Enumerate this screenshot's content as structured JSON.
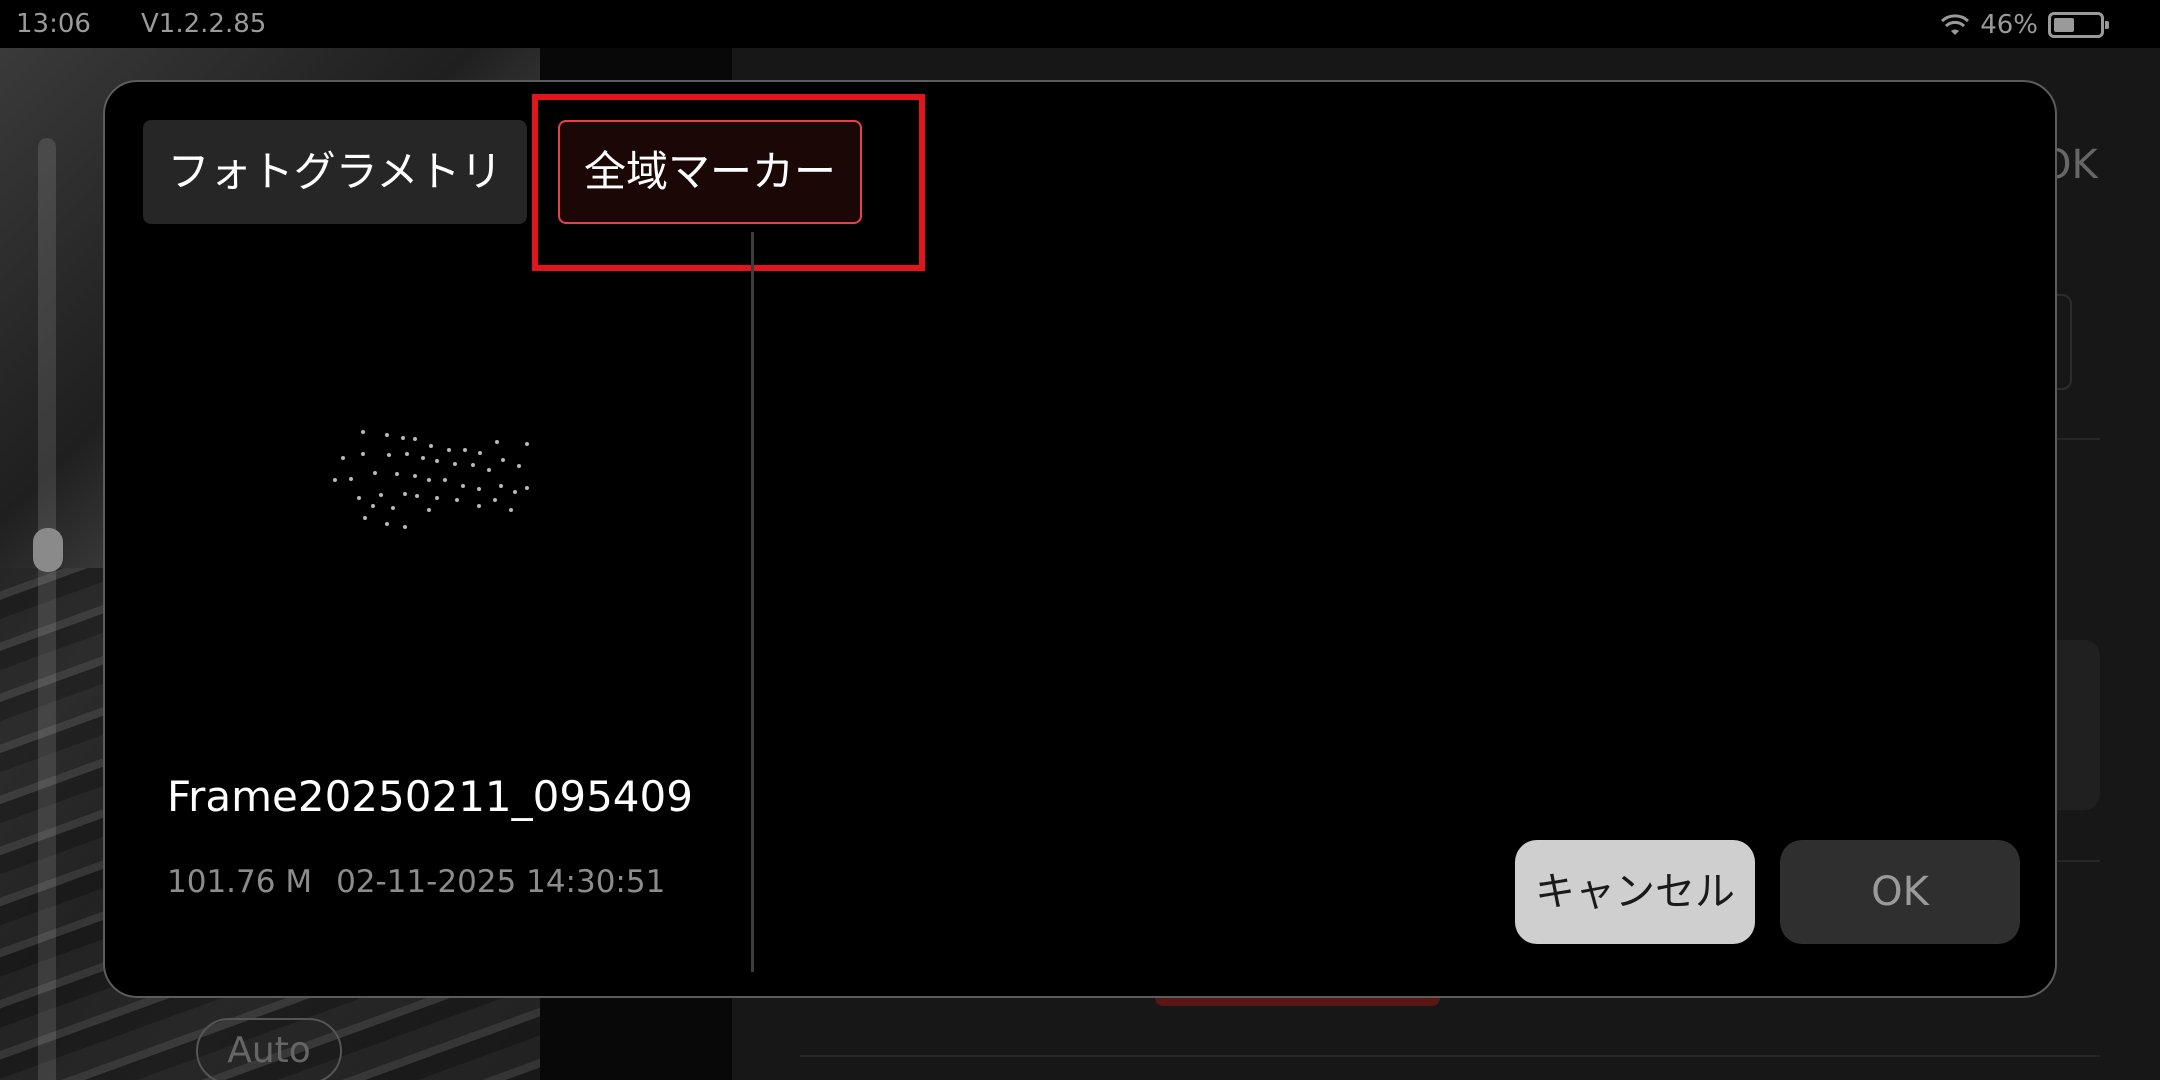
{
  "status_bar": {
    "time": "13:06",
    "version": "V1.2.2.85",
    "battery_percent": "46%",
    "battery_level": 0.46
  },
  "background": {
    "ok_label": "OK",
    "auto_label": "Auto"
  },
  "dialog": {
    "tabs": [
      {
        "label": "フォトグラメトリ",
        "selected": false
      },
      {
        "label": "全域マーカー",
        "selected": true
      }
    ],
    "file": {
      "name": "Frame20250211_095409",
      "size": "101.76 M",
      "date": "02-11-2025 14:30:51"
    },
    "buttons": {
      "cancel": "キャンセル",
      "ok": "OK"
    }
  },
  "colors": {
    "accent": "#e3424a",
    "highlight": "#e3151c",
    "dialog_bg": "#000000",
    "tab_bg": "#262626"
  }
}
